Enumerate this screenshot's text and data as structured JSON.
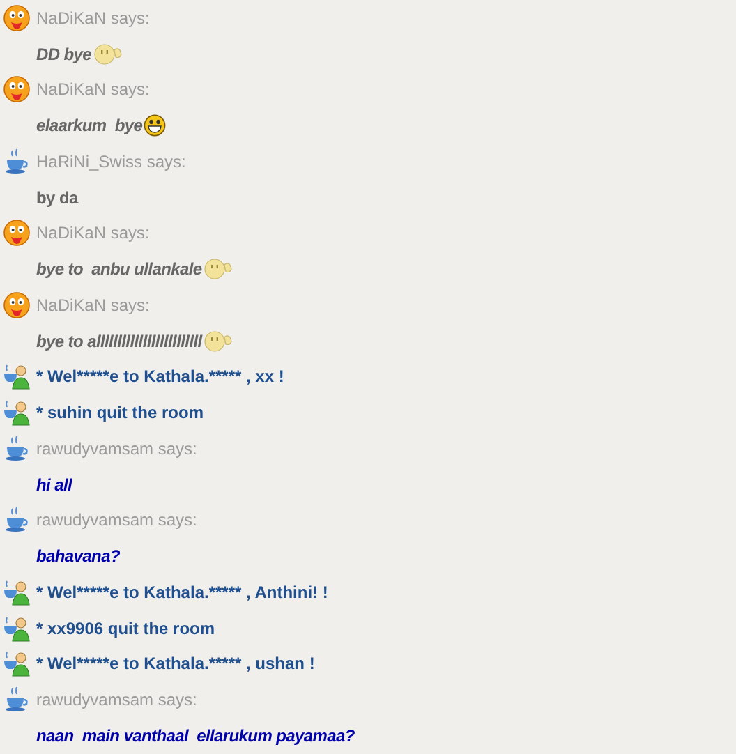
{
  "messages": [
    {
      "kind": "header",
      "avatar": {
        "kind": "tongue"
      },
      "sender": "NaDiKaN says:"
    },
    {
      "kind": "message",
      "text": "DD bye",
      "color": "#666666",
      "italic": true,
      "emote": {
        "kind": "wave"
      }
    },
    {
      "kind": "header",
      "avatar": {
        "kind": "tongue"
      },
      "sender": "NaDiKaN says:"
    },
    {
      "kind": "message",
      "text": "elaarkum  bye",
      "color": "#666666",
      "italic": true,
      "emote": {
        "kind": "grin"
      }
    },
    {
      "kind": "header",
      "avatar": {
        "kind": "cup"
      },
      "sender": "HaRiNi_Swiss says:"
    },
    {
      "kind": "message",
      "text": "by da",
      "color": "#666666",
      "italic": false
    },
    {
      "kind": "header",
      "avatar": {
        "kind": "tongue"
      },
      "sender": "NaDiKaN says:"
    },
    {
      "kind": "message",
      "text": "bye to  anbu ullankale",
      "color": "#666666",
      "italic": true,
      "emote": {
        "kind": "wave"
      }
    },
    {
      "kind": "header",
      "avatar": {
        "kind": "tongue"
      },
      "sender": "NaDiKaN says:"
    },
    {
      "kind": "message",
      "text": "bye to alllllllllllllllllllllllll",
      "color": "#666666",
      "italic": true,
      "emote": {
        "kind": "wave"
      }
    },
    {
      "kind": "system",
      "text": "* Wel*****e to Kathala.***** , xx !"
    },
    {
      "kind": "system",
      "text": "* suhin quit the room"
    },
    {
      "kind": "header",
      "avatar": {
        "kind": "cup"
      },
      "sender": "rawudyvamsam says:"
    },
    {
      "kind": "message",
      "text": "hi all",
      "color": "#0000aa",
      "italic": true
    },
    {
      "kind": "header",
      "avatar": {
        "kind": "cup"
      },
      "sender": "rawudyvamsam says:"
    },
    {
      "kind": "message",
      "text": "bahavana?",
      "color": "#0000aa",
      "italic": true
    },
    {
      "kind": "system",
      "text": "* Wel*****e to Kathala.***** , Anthini! !"
    },
    {
      "kind": "system",
      "text": "* xx9906 quit the room"
    },
    {
      "kind": "system",
      "text": "* Wel*****e to Kathala.***** , ushan !"
    },
    {
      "kind": "header",
      "avatar": {
        "kind": "cup"
      },
      "sender": "rawudyvamsam says:"
    },
    {
      "kind": "message",
      "text": "naan  main vanthaal  ellarukum payamaa?",
      "color": "#0000aa",
      "italic": true
    }
  ]
}
